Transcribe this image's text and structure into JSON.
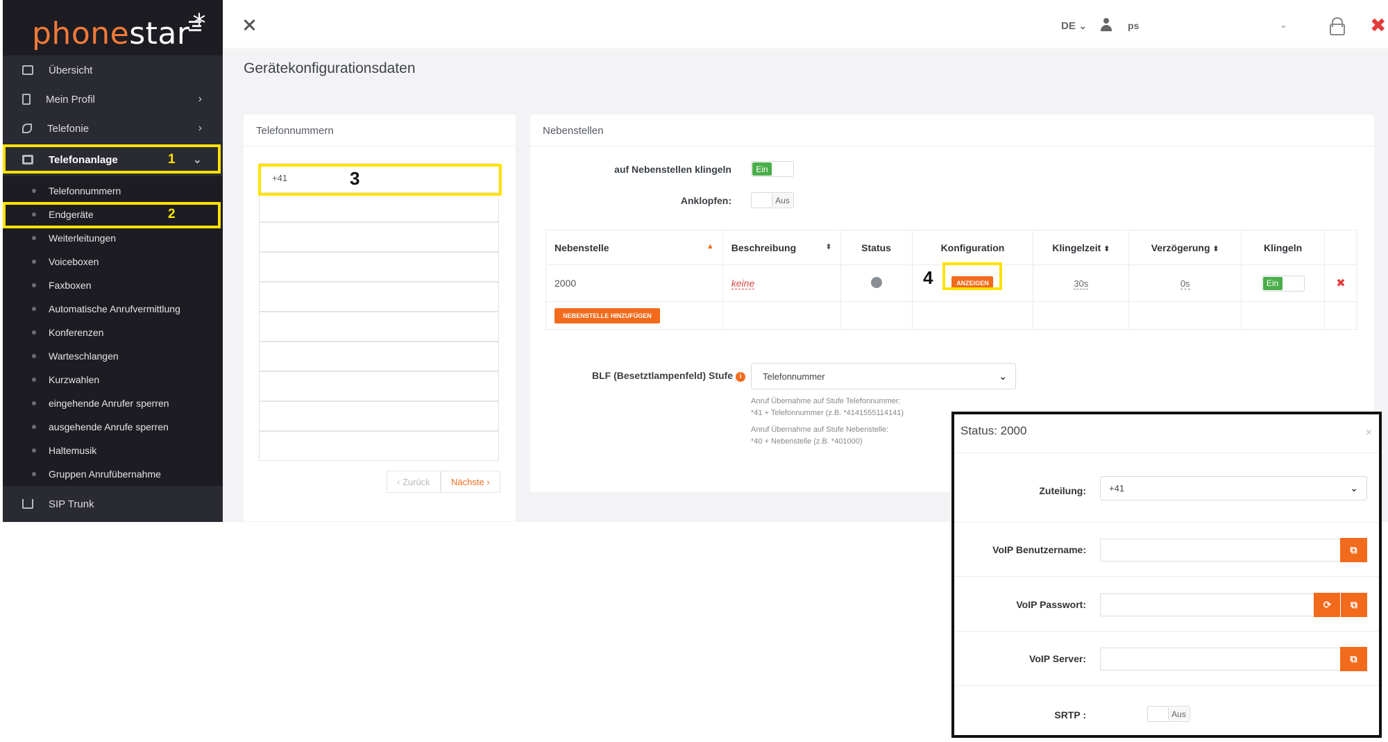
{
  "brand": {
    "logo_part1": "phone",
    "logo_part2": "star",
    "logo_star": "*"
  },
  "sidebar": {
    "main_items": [
      {
        "label": "Übersicht",
        "icon": "monitor-icon"
      },
      {
        "label": "Mein Profil",
        "icon": "document-icon",
        "chevron": "›"
      },
      {
        "label": "Telefonie",
        "icon": "phone-icon",
        "chevron": "›"
      },
      {
        "label": "Telefonanlage",
        "icon": "server-icon",
        "chevron": "⌄",
        "active": true,
        "marker": "1"
      }
    ],
    "sub_items": [
      "Telefonnummern",
      "Endgeräte",
      "Weiterleitungen",
      "Voiceboxen",
      "Faxboxen",
      "Automatische Anrufvermittlung",
      "Konferenzen",
      "Warteschlangen",
      "Kurzwahlen",
      "eingehende Anrufer sperren",
      "ausgehende Anrufe sperren",
      "Haltemusik",
      "Gruppen Anrufübernahme"
    ],
    "sub_marker": "2",
    "bottom_item": {
      "label": "SIP Trunk",
      "icon": "download-icon"
    }
  },
  "topbar": {
    "language": "DE ⌄",
    "user": "ps",
    "user_chevron": "⌄",
    "close": "✖"
  },
  "page": {
    "title": "Gerätekonfigurationsdaten"
  },
  "numbers_panel": {
    "title": "Telefonnummern",
    "first_number": "+41",
    "marker": "3",
    "prev_label": "‹ Zurück",
    "next_label": "Nächste ›"
  },
  "extensions_panel": {
    "title": "Nebenstellen",
    "ring_label": "auf Nebenstellen klingeln",
    "ring_on": "Ein",
    "knock_label": "Anklopfen:",
    "knock_off": "Aus",
    "table": {
      "headers": [
        "Nebenstelle",
        "Beschreibung",
        "Status",
        "Konfiguration",
        "Klingelzeit",
        "Verzögerung",
        "Klingeln"
      ],
      "rows": [
        {
          "extension": "2000",
          "description": "keine",
          "config_button": "ANZEIGEN",
          "ring_time": "30s",
          "delay": "0s",
          "ring_on": "Ein",
          "delete": "✖"
        }
      ],
      "add_button": "NEBENSTELLE HINZUFÜGEN"
    },
    "marker": "4",
    "blf_label": "BLF (Besetztlampenfeld) Stufe",
    "blf_select": "Telefonnummer",
    "help_1a": "Anruf Übernahme auf Stufe Telefonnummer:",
    "help_1b": "*41 + Telefonnummer (z.B. *4141555114141)",
    "help_2a": "Anruf Übernahme auf Stufe Nebenstelle:",
    "help_2b": "*40 + Nebenstelle (z.B. *401000)"
  },
  "modal": {
    "title": "Status: 2000",
    "close": "×",
    "assign_label": "Zuteilung:",
    "assign_value": "+41",
    "user_label": "VoIP Benutzername:",
    "password_label": "VoIP Passwort:",
    "server_label": "VoIP Server:",
    "srtp_label": "SRTP :",
    "srtp_off": "Aus"
  },
  "colors": {
    "accent": "#f26a1b",
    "highlight": "#ffe200",
    "sidebar": "#2a2a33",
    "success": "#4aae4a",
    "danger": "#e23b3b"
  }
}
